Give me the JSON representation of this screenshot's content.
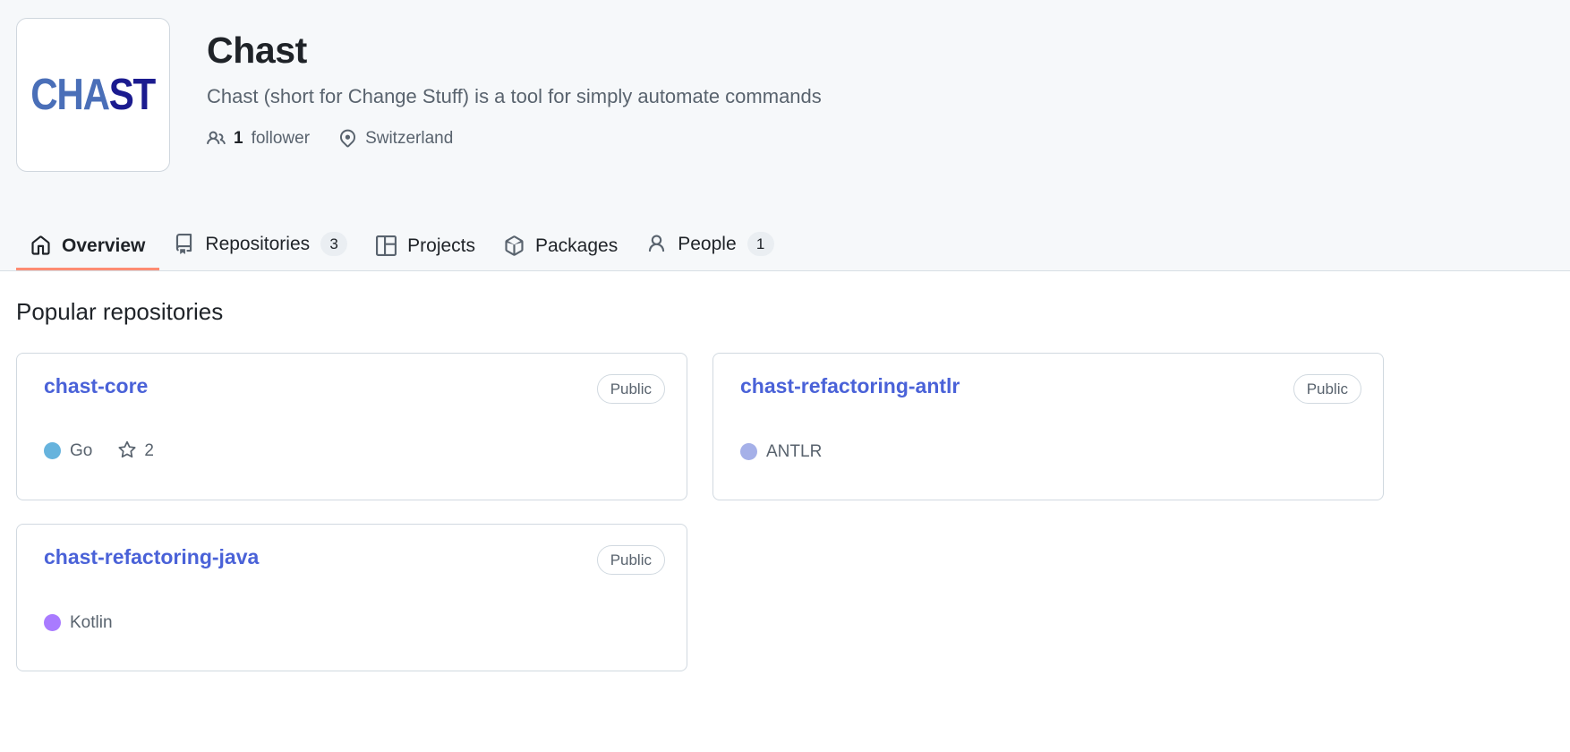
{
  "org": {
    "name": "Chast",
    "description": "Chast (short for Change Stuff) is a tool for simply automate commands",
    "avatar_logo_part1": "CHA",
    "avatar_logo_part2": "ST",
    "avatar_logo_color1": "#4a6fb8",
    "avatar_logo_color2": "#1b1b8f",
    "meta": {
      "followers_count": "1",
      "followers_label": "follower",
      "followers_icon": "people-icon",
      "location": "Switzerland",
      "location_icon": "location-pin-icon"
    }
  },
  "nav": {
    "active_underline_color": "#fd8c73",
    "tabs": [
      {
        "label": "Overview",
        "icon": "home-icon",
        "counter": null,
        "active": true
      },
      {
        "label": "Repositories",
        "icon": "repo-icon",
        "counter": "3",
        "active": false
      },
      {
        "label": "Projects",
        "icon": "project-icon",
        "counter": null,
        "active": false
      },
      {
        "label": "Packages",
        "icon": "package-icon",
        "counter": null,
        "active": false
      },
      {
        "label": "People",
        "icon": "person-icon",
        "counter": "1",
        "active": false
      }
    ]
  },
  "main": {
    "section_title": "Popular repositories",
    "repositories": [
      {
        "name": "chast-core",
        "visibility": "Public",
        "language": "Go",
        "language_color": "#66b3dd",
        "stars": "2",
        "star_icon": "star-icon"
      },
      {
        "name": "chast-refactoring-antlr",
        "visibility": "Public",
        "language": "ANTLR",
        "language_color": "#a5b0e8",
        "stars": null,
        "star_icon": "star-icon"
      },
      {
        "name": "chast-refactoring-java",
        "visibility": "Public",
        "language": "Kotlin",
        "language_color": "#a97bff",
        "stars": null,
        "star_icon": "star-icon"
      }
    ]
  }
}
